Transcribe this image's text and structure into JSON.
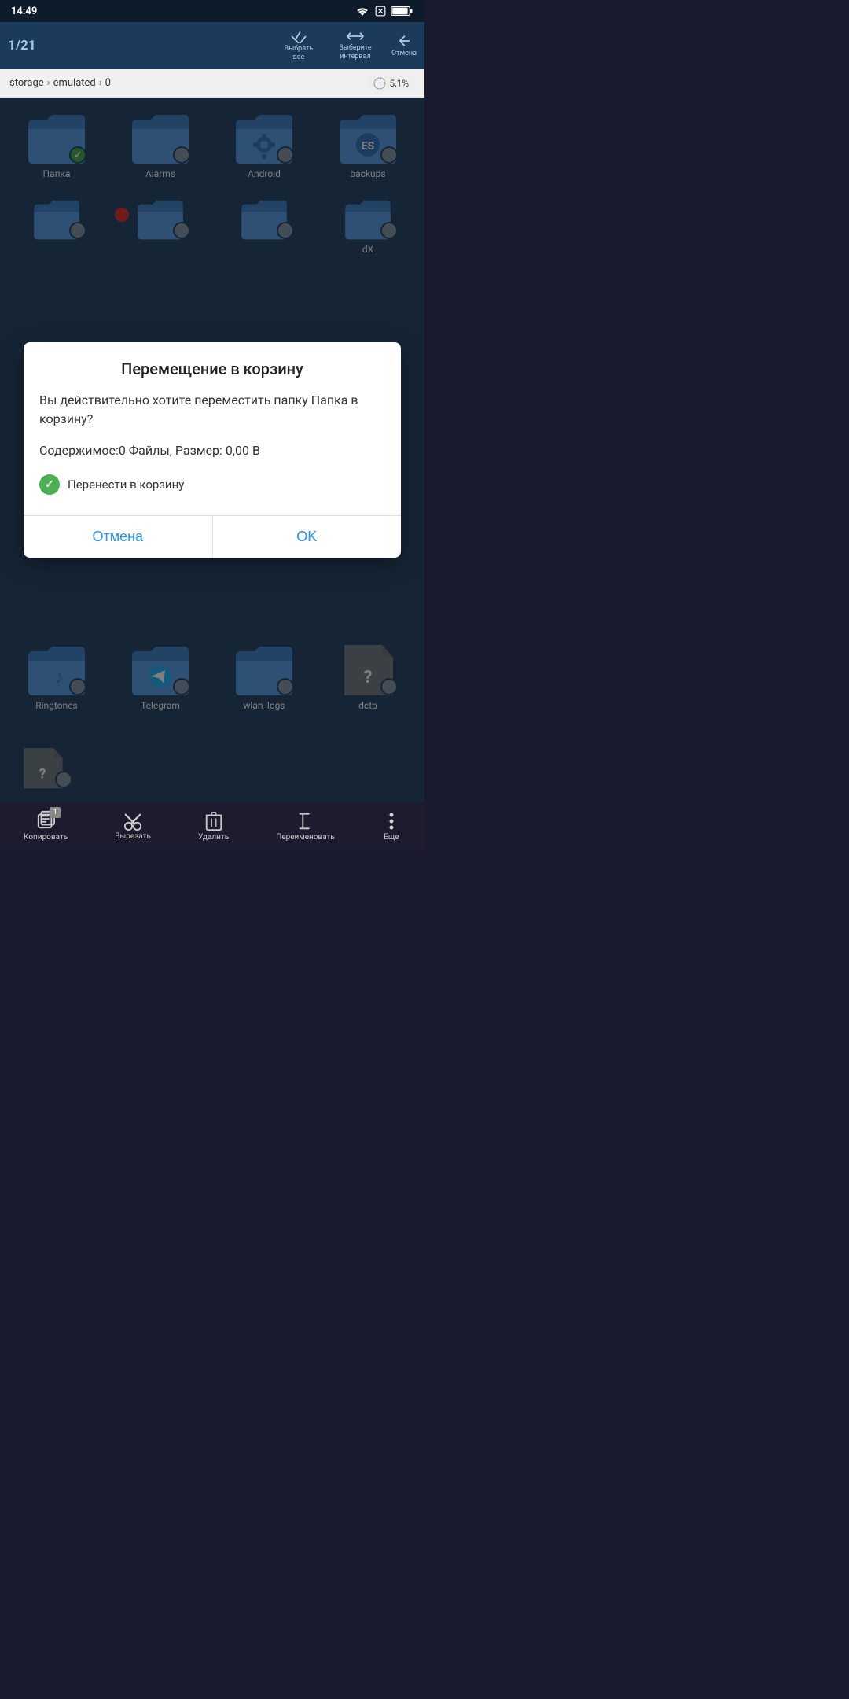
{
  "statusBar": {
    "time": "14:49"
  },
  "toolbar": {
    "count": "1/21",
    "selectAll": "Выбрать все",
    "selectInterval": "Выберите интервал",
    "cancel": "Отмена"
  },
  "breadcrumb": {
    "items": [
      "storage",
      "emulated",
      "0"
    ],
    "storagePercent": "5,1%"
  },
  "topFolders": [
    {
      "label": "Папка",
      "selected": true,
      "icon": "folder"
    },
    {
      "label": "Alarms",
      "selected": false,
      "icon": "folder"
    },
    {
      "label": "Android",
      "selected": false,
      "icon": "folder-settings"
    },
    {
      "label": "backups",
      "selected": false,
      "icon": "folder-es"
    }
  ],
  "midFolders": [
    {
      "label": "",
      "selected": false,
      "icon": "folder",
      "partial": true
    },
    {
      "label": "",
      "selected": false,
      "icon": "folder",
      "partial": true
    },
    {
      "label": "",
      "selected": false,
      "icon": "folder",
      "partial": true
    },
    {
      "label": "dX",
      "selected": false,
      "icon": "folder",
      "partial": true
    }
  ],
  "dialog": {
    "title": "Перемещение в корзину",
    "message": "Вы действительно хотите переместить папку Папка в корзину?",
    "info": "Содержимое:0 Файлы, Размер: 0,00 В",
    "checkboxLabel": "Перенести в корзину",
    "cancelLabel": "Отмена",
    "okLabel": "OK"
  },
  "bottomFolders": [
    {
      "label": "Ringtones",
      "icon": "folder-music"
    },
    {
      "label": "Telegram",
      "icon": "folder-telegram"
    },
    {
      "label": "wlan_logs",
      "icon": "folder"
    },
    {
      "label": "dctp",
      "icon": "file-unknown"
    }
  ],
  "extraFolder": [
    {
      "label": "",
      "icon": "file-unknown",
      "partial": true
    }
  ],
  "bottomToolbar": {
    "copy": "Копировать",
    "cut": "Вырезать",
    "delete": "Удалить",
    "rename": "Переименовать",
    "more": "Еще",
    "copyCount": "1"
  }
}
